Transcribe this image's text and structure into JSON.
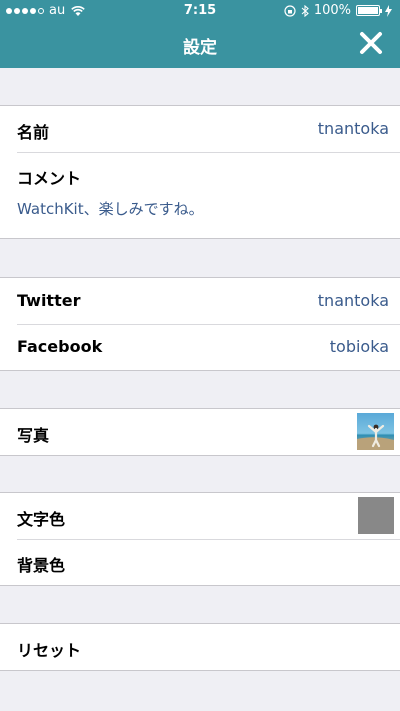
{
  "status_bar": {
    "carrier": "au",
    "time": "7:15",
    "battery": "100%"
  },
  "nav": {
    "title": "設定",
    "close_icon": "close-icon"
  },
  "profile": {
    "name_label": "名前",
    "name_value": "tnantoka",
    "comment_label": "コメント",
    "comment_value": "WatchKit、楽しみですね。"
  },
  "social": {
    "twitter_label": "Twitter",
    "twitter_value": "tnantoka",
    "facebook_label": "Facebook",
    "facebook_value": "tobioka"
  },
  "photo": {
    "label": "写真",
    "thumbnail_icon": "photo-thumbnail"
  },
  "colors": {
    "text_color_label": "文字色",
    "text_color_value": "#888888",
    "background_color_label": "背景色"
  },
  "reset": {
    "label": "リセット"
  },
  "theme": {
    "nav_bar": "#3a93a0",
    "accent_value": "#3a5b8c",
    "background": "#efeff4"
  }
}
